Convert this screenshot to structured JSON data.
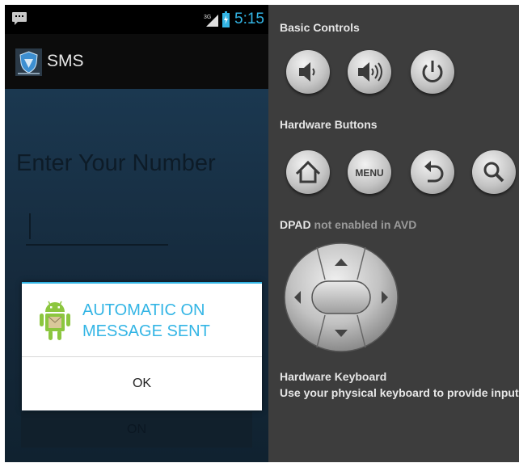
{
  "phone": {
    "status_bar": {
      "signal": "3G",
      "time": "5:15"
    },
    "action_bar": {
      "title": "SMS",
      "logo": "shield-logo"
    },
    "content": {
      "prompt": "Enter Your Number",
      "number_value": "",
      "on_button": "ON"
    },
    "dialog": {
      "title": "AUTOMATIC ON\nMESSAGE SENT",
      "icon": "android-icon",
      "ok_button": "OK"
    }
  },
  "panel": {
    "basic_controls": {
      "label": "Basic Controls",
      "buttons": [
        "volume-down-icon",
        "volume-up-icon",
        "power-icon"
      ]
    },
    "hardware_buttons": {
      "label": "Hardware Buttons",
      "buttons": [
        "home-icon",
        "menu",
        "back-icon",
        "search-icon"
      ],
      "menu_label": "MENU"
    },
    "dpad": {
      "label_bold": "DPAD",
      "label_rest": "not enabled in AVD"
    },
    "keyboard": {
      "label": "Hardware Keyboard",
      "hint": "Use your physical keyboard to provide input"
    }
  },
  "colors": {
    "accent": "#33b5e5",
    "panel_bg": "#3d3d3d",
    "screen_bg": "#16293b"
  }
}
